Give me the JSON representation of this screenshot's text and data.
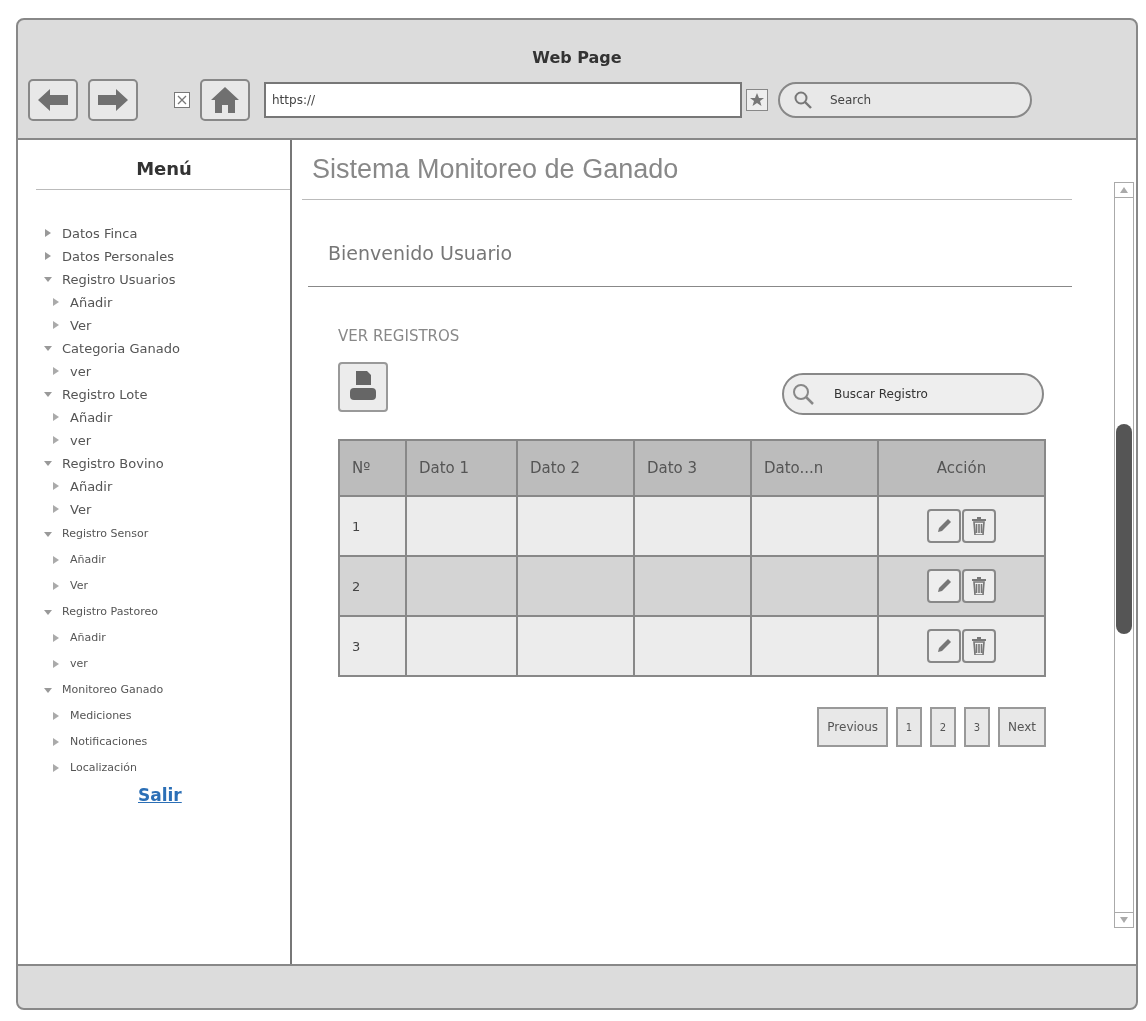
{
  "window": {
    "title": "Web Page"
  },
  "browser": {
    "url": "https://",
    "search_placeholder": "Search"
  },
  "sidebar": {
    "title": "Menú",
    "items": [
      {
        "label": "Datos Finca",
        "expanded": false
      },
      {
        "label": "Datos Personales",
        "expanded": false
      },
      {
        "label": "Registro Usuarios",
        "expanded": true,
        "children": [
          {
            "label": "Añadir",
            "expanded": false
          },
          {
            "label": "Ver",
            "expanded": false
          }
        ]
      },
      {
        "label": "Categoria Ganado",
        "expanded": true,
        "children": [
          {
            "label": "ver",
            "expanded": false
          }
        ]
      },
      {
        "label": "Registro Lote",
        "expanded": true,
        "children": [
          {
            "label": "Añadir",
            "expanded": false
          },
          {
            "label": "ver",
            "expanded": false
          }
        ]
      },
      {
        "label": "Registro Bovino",
        "expanded": true,
        "children": [
          {
            "label": "Añadir",
            "expanded": false
          },
          {
            "label": "Ver",
            "expanded": false
          }
        ]
      },
      {
        "label": "Registro Sensor",
        "expanded": true,
        "children": [
          {
            "label": "Añadir",
            "expanded": false
          },
          {
            "label": "Ver",
            "expanded": false
          }
        ]
      },
      {
        "label": "Registro Pastoreo",
        "expanded": true,
        "children": [
          {
            "label": "Añadir",
            "expanded": false
          },
          {
            "label": "ver",
            "expanded": false
          }
        ]
      },
      {
        "label": "Monitoreo Ganado",
        "expanded": true,
        "children": [
          {
            "label": "Mediciones",
            "expanded": false
          },
          {
            "label": "Notificaciones",
            "expanded": false
          },
          {
            "label": "Localización",
            "expanded": false
          }
        ]
      }
    ],
    "logout": "Salir"
  },
  "header": {
    "title": "Sistema Monitoreo de Ganado"
  },
  "welcome": "Bienvenido Usuario",
  "section": {
    "title": "VER REGISTROS",
    "search_placeholder": "Buscar Registro"
  },
  "table": {
    "columns": [
      "Nº",
      "Dato 1",
      "Dato 2",
      "Dato 3",
      "Dato...n",
      "Acción"
    ],
    "rows": [
      {
        "cells": [
          "1",
          "",
          "",
          "",
          ""
        ]
      },
      {
        "cells": [
          "2",
          "",
          "",
          "",
          ""
        ]
      },
      {
        "cells": [
          "3",
          "",
          "",
          "",
          ""
        ]
      }
    ]
  },
  "pagination": {
    "previous": "Previous",
    "pages": [
      "1",
      "2",
      "3"
    ],
    "next": "Next"
  }
}
